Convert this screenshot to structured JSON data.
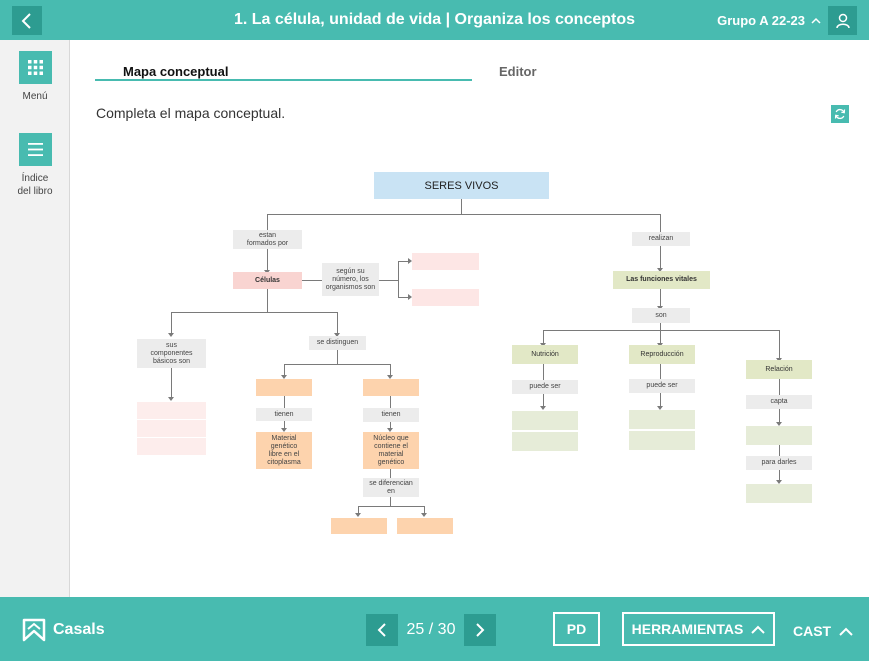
{
  "header": {
    "title": "1. La célula, unidad de vida | Organiza los conceptos",
    "group": "Grupo A 22-23"
  },
  "sidebar": {
    "menu_label": "Menú",
    "index_label_1": "Índice",
    "index_label_2": "del libro"
  },
  "tabs": {
    "active": "Mapa conceptual",
    "inactive": "Editor"
  },
  "instruction": "Completa el mapa conceptual.",
  "concept_map": {
    "root": "SERES VIVOS",
    "estan_formados_1": "estan",
    "estan_formados_2": "formados por",
    "realizan": "realizan",
    "celulas": "Células",
    "segun_1": "según su",
    "segun_2": "número, los",
    "segun_3": "organismos son",
    "funciones": "Las funciones vitales",
    "son": "son",
    "sus_comp_1": "sus",
    "sus_comp_2": "componentes",
    "sus_comp_3": "básicos son",
    "se_distinguen": "se distinguen",
    "nutricion": "Nutrición",
    "reproduccion": "Reproducción",
    "relacion": "Relación",
    "puede_ser_1": "puede ser",
    "puede_ser_2": "puede ser",
    "capta": "capta",
    "para_darles": "para darles",
    "tienen_1": "tienen",
    "tienen_2": "tienen",
    "material_1": "Material",
    "material_2": "genético",
    "material_3": "libre en el",
    "material_4": "citoplasma",
    "nucleo_1": "Núcleo que",
    "nucleo_2": "contiene el",
    "nucleo_3": "material",
    "nucleo_4": "genético",
    "diferencian_1": "se diferencian",
    "diferencian_2": "en"
  },
  "footer": {
    "brand": "Casals",
    "current_page": "25",
    "total_pages": "30",
    "page_sep": " / ",
    "pd_label": "PD",
    "tools_label": "HERRAMIENTAS",
    "lang_label": "CAST"
  },
  "colors": {
    "accent": "#48bbb0",
    "accent_dark": "#2d9c91",
    "root_node": "#c9e3f4",
    "pink_node": "#f9d4d1",
    "green_node": "#e2e8c6",
    "orange_node": "#fdd3ad"
  }
}
